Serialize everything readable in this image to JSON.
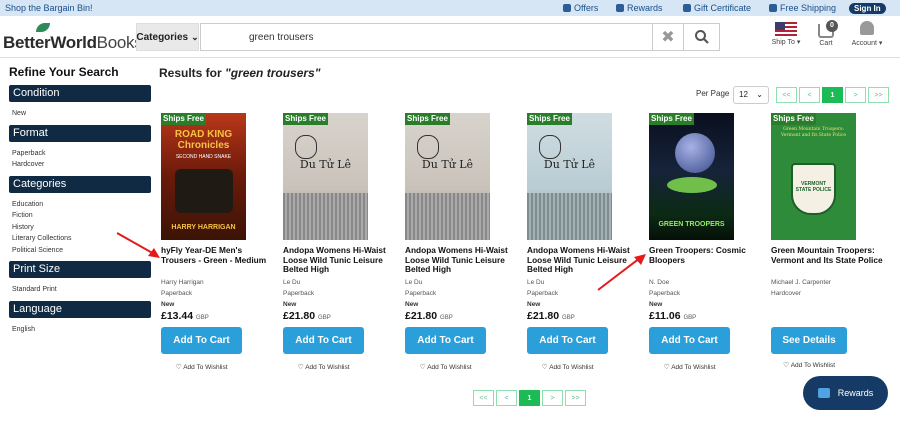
{
  "topbar": {
    "promo": "Shop the Bargain Bin!",
    "offers": "Offers",
    "rewards": "Rewards",
    "gift": "Gift Certificate",
    "free_shipping": "Free Shipping",
    "signin": "Sign In"
  },
  "header": {
    "logo_main": "BetterWorld",
    "logo_books": "Books",
    "logo_tm": "®",
    "categories_label": "Categories",
    "search_value": "green trousers",
    "ship_to": "Ship To",
    "cart_label": "Cart",
    "cart_count": "0",
    "account_label": "Account"
  },
  "sidebar": {
    "title": "Refine Your Search",
    "sections": [
      {
        "heading": "Condition",
        "items": [
          "New"
        ]
      },
      {
        "heading": "Format",
        "items": [
          "Paperback",
          "Hardcover"
        ]
      },
      {
        "heading": "Categories",
        "items": [
          "Education",
          "Fiction",
          "History",
          "Literary Collections",
          "Political Science"
        ]
      },
      {
        "heading": "Print Size",
        "items": [
          "Standard Print"
        ]
      },
      {
        "heading": "Language",
        "items": [
          "English"
        ]
      }
    ]
  },
  "results": {
    "prefix": "Results for ",
    "query": "\"green trousers\"",
    "per_page_label": "Per Page",
    "per_page_value": "12",
    "pager": [
      "<<",
      "<",
      "1",
      ">",
      ">>"
    ],
    "current_page": "1"
  },
  "products": [
    {
      "ships_free": "Ships Free",
      "title": "hyFly Year-DE Men's Trousers - Green - Medium",
      "author": "Harry Harrigan",
      "format": "Paperback",
      "condition": "New",
      "price": "£13.44",
      "currency": "GBP",
      "button": "Add To Cart",
      "wishlist": "Add To Wishlist",
      "cover_text": "ROAD KING Chronicles",
      "cover_sub": "SECOND HAND SNAKE",
      "cover_author": "HARRY HARRIGAN"
    },
    {
      "ships_free": "Ships Free",
      "title": "Andopa Womens Hi-Waist Loose Wild Tunic Leisure Belted High",
      "author": "Le Du",
      "format": "Paperback",
      "condition": "New",
      "price": "£21.80",
      "currency": "GBP",
      "button": "Add To Cart",
      "wishlist": "Add To Wishlist",
      "cover_text": "Du Tử Lê"
    },
    {
      "ships_free": "Ships Free",
      "title": "Andopa Womens Hi-Waist Loose Wild Tunic Leisure Belted High",
      "author": "Le Du",
      "format": "Paperback",
      "condition": "New",
      "price": "£21.80",
      "currency": "GBP",
      "button": "Add To Cart",
      "wishlist": "Add To Wishlist",
      "cover_text": "Du Tử Lê"
    },
    {
      "ships_free": "Ships Free",
      "title": "Andopa Womens Hi-Waist Loose Wild Tunic Leisure Belted High",
      "author": "Le Du",
      "format": "Paperback",
      "condition": "New",
      "price": "£21.80",
      "currency": "GBP",
      "button": "Add To Cart",
      "wishlist": "Add To Wishlist",
      "cover_text": "Du Tử Lê"
    },
    {
      "ships_free": "Ships Free",
      "title": "Green Troopers: Cosmic Bloopers",
      "author": "N. Doe",
      "format": "Paperback",
      "condition": "New",
      "price": "£11.06",
      "currency": "GBP",
      "button": "Add To Cart",
      "wishlist": "Add To Wishlist",
      "cover_text": "GREEN TROOPERS"
    },
    {
      "ships_free": "Ships Free",
      "title": "Green Mountain Troopers: Vermont and Its State Police",
      "author": "Michael J. Carpenter",
      "format": "Hardcover",
      "condition": "",
      "price": "",
      "currency": "",
      "button": "See Details",
      "wishlist": "Add To Wishlist",
      "cover_text": "Green Mountain Troopers: Vermont and Its State Police",
      "cover_badge": "VERMONT STATE POLICE"
    }
  ],
  "rewards_button": "Rewards",
  "colors": {
    "navy": "#102a43",
    "accent_blue": "#2a9fd9",
    "green": "#1dbb55",
    "arrow_red": "#e31b1b"
  }
}
